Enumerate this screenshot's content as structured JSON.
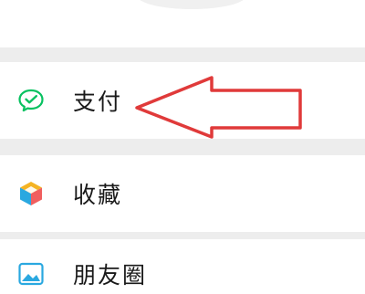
{
  "menu": {
    "items": [
      {
        "label": "支付",
        "icon": "wechat-pay-icon"
      },
      {
        "label": "收藏",
        "icon": "favorites-cube-icon"
      },
      {
        "label": "朋友圈",
        "icon": "moments-picture-icon"
      }
    ]
  },
  "annotation": {
    "icon": "red-arrow-annotation"
  },
  "colors": {
    "background": "#ededed",
    "card": "#ffffff",
    "pay_green": "#07c160",
    "arrow_red": "#e03a3a"
  }
}
